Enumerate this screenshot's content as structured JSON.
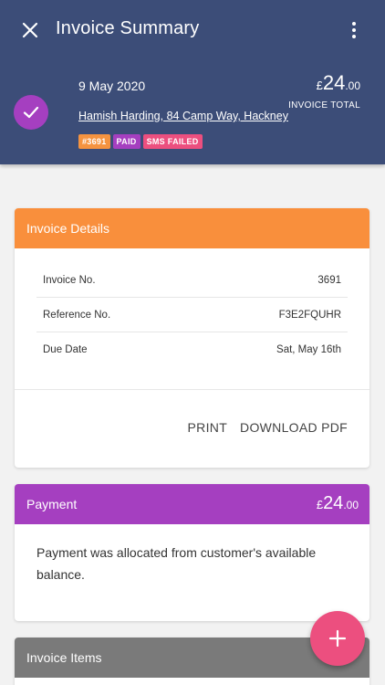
{
  "header": {
    "title": "Invoice Summary",
    "date": "9 May 2020",
    "customer": "Hamish Harding, 84 Camp Way, Hackney",
    "badges": [
      "#3691",
      "PAID",
      "SMS FAILED"
    ],
    "total": {
      "currency": "£",
      "whole": "24",
      "cents": ".00",
      "label": "INVOICE TOTAL"
    }
  },
  "details": {
    "title": "Invoice Details",
    "rows": [
      {
        "label": "Invoice No.",
        "value": "3691"
      },
      {
        "label": "Reference No.",
        "value": "F3E2FQUHR"
      },
      {
        "label": "Due Date",
        "value": "Sat, May 16th"
      }
    ],
    "print_label": "PRINT",
    "download_label": "DOWNLOAD PDF"
  },
  "payment": {
    "title": "Payment",
    "amount": {
      "currency": "£",
      "whole": "24",
      "cents": ".00"
    },
    "text": "Payment was allocated from customer's available balance."
  },
  "items": {
    "title": "Invoice Items"
  },
  "colors": {
    "header_bg": "#3c4d78",
    "details_header": "#f98f3c",
    "payment_header": "#a53fc0",
    "items_header": "#7a7a7a",
    "fab": "#ec4f7f"
  },
  "icons": {
    "close": "close-icon",
    "more": "more-vertical-icon",
    "check": "check-icon",
    "add": "plus-icon"
  }
}
